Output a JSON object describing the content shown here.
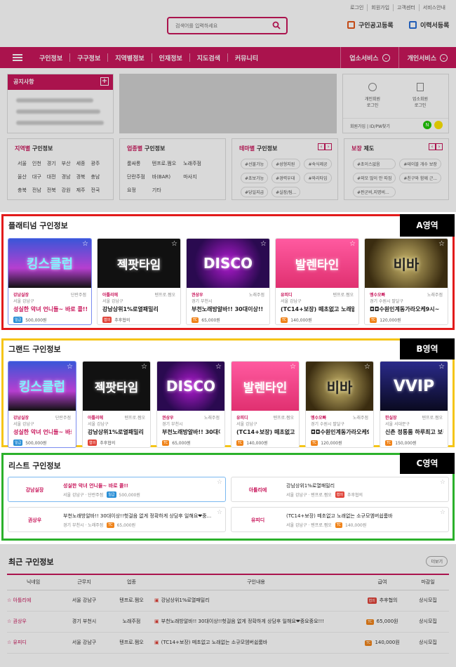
{
  "topnav": [
    "로그인",
    "회원가입",
    "고객센터",
    "서비스안내"
  ],
  "search": {
    "placeholder": "검색어를 입력하세요"
  },
  "links": {
    "job_post": "구인공고등록",
    "resume": "이력서등록"
  },
  "nav": {
    "items": [
      "구인정보",
      "구구정보",
      "지역별정보",
      "인재정보",
      "지도검색",
      "커뮤니티"
    ],
    "biz": "업소서비스",
    "personal": "개인서비스"
  },
  "notice": {
    "title": "공지사항"
  },
  "login": {
    "biz": "개인회원\n로그인",
    "biz2": "업소회원\n로그인",
    "links": "회원가입 | ID/PW찾기"
  },
  "region_box": {
    "title": "지역별",
    "suffix": " 구인정보",
    "items": [
      "서울",
      "인천",
      "경기",
      "부산",
      "세종",
      "광주",
      "울산",
      "대구",
      "대전",
      "경남",
      "경북",
      "충남",
      "충북",
      "전남",
      "전북",
      "강원",
      "제주",
      "전국"
    ]
  },
  "job_box": {
    "title": "업종별",
    "suffix": " 구인정보",
    "items": [
      "룸싸롱",
      "텐프로.쩜오",
      "노래주점",
      "단란주점",
      "바(BAR)",
      "마사지",
      "요정",
      "기타"
    ]
  },
  "theme_box": {
    "title": "테마별",
    "suffix": " 구인정보",
    "items": [
      "#선불가능",
      "#성형지원",
      "#숙식제공",
      "#초보가능",
      "#경력우대",
      "#와리타임",
      "#당일지급",
      "#실장/팀..."
    ]
  },
  "guar_box": {
    "title": "보장",
    "suffix": " 제도",
    "items": [
      "#초이스없음",
      "#테이블 개수 보장",
      "#외모 많이 안 따짐",
      "#친구와 함께 근...",
      "#판군비,지명비..."
    ]
  },
  "sections": {
    "platinum": {
      "title": "플래티넘 구인정보",
      "label": "A영역"
    },
    "grand": {
      "title": "그랜드 구인정보",
      "label": "B영역"
    },
    "list": {
      "title": "리스트 구인정보",
      "label": "C영역"
    }
  },
  "cards": [
    {
      "thumb": "킹스클럽",
      "name": "강남실장",
      "type": "단란주점",
      "loc": "서울 강남구",
      "title": "성실한 악녀 언니들~ 바로 콜!!",
      "pay_badge": "일급",
      "pay": "500,000원"
    },
    {
      "thumb": "젝팟타임",
      "name": "아틀리에",
      "type": "텐프로.쩜오",
      "loc": "서울 강남구",
      "title": "강남상위1%로열패밀리",
      "pay_badge": "협의",
      "pay": "추후협의"
    },
    {
      "thumb": "DISCO",
      "name": "권상우",
      "type": "노래주점",
      "loc": "경기 부천시",
      "title": "부천노래방알바!! 30대이상!!",
      "pay_badge": "TC",
      "pay": "65,000원"
    },
    {
      "thumb": "발렌타인",
      "name": "유피디",
      "type": "텐프로.쩜오",
      "loc": "서울 강남구",
      "title": "(TC14+보장) 떼초없고 노래없는",
      "pay_badge": "TC",
      "pay": "140,000원"
    },
    {
      "thumb": "비바",
      "name": "멩수오빠",
      "type": "노래주점",
      "loc": "경기 수원시 팔달구",
      "title": "◘◘수원인계동가라오케9시~",
      "pay_badge": "TC",
      "pay": "120,000원"
    },
    {
      "thumb": "VVIP",
      "name": "한실장",
      "type": "텐프로.쩜오",
      "loc": "서울 서대문구",
      "title": "신촌 정통룸 하루최고 보장",
      "pay_badge": "TC",
      "pay": "150,000원"
    }
  ],
  "list_rows": [
    {
      "name": "강남실장",
      "title": "성실한 악녀 언니들~ 바로 콜!!",
      "loc": "서울 강남구 · 단란주점",
      "badge": "일급",
      "pay": "500,000원"
    },
    {
      "name": "아틀리에",
      "title": "강남상위1%로열패밀리",
      "loc": "서울 강남구 · 텐프로.쩜오",
      "badge": "협의",
      "pay": "추후협의"
    },
    {
      "name": "권상우",
      "title": "부천노래방알바!! 30대이상!!헛걸음 없게 정확하게 상담후 일해요❤중...",
      "loc": "경기 부천시 · 노래주점",
      "badge": "TC",
      "pay": "65,000원"
    },
    {
      "name": "유피디",
      "title": "(TC14+보장) 떼초없고 노래없는 소규모엠버쉽룸바",
      "loc": "서울 강남구 · 텐프로.쩜오",
      "badge": "TC",
      "pay": "140,000원"
    }
  ],
  "recent": {
    "title": "최근 구인정보",
    "more": "더보기",
    "headers": [
      "닉네임",
      "근무지",
      "업종",
      "구인내용",
      "급여",
      "마감일"
    ],
    "rows": [
      {
        "name": "아틀리에",
        "loc": "서울 강남구",
        "type": "텐프로.쩜오",
        "content": "강남상위1%로열패밀리",
        "badge": "협의",
        "pay": "추후협의",
        "deadline": "상시모집"
      },
      {
        "name": "권상우",
        "loc": "경기 부천시",
        "type": "노래주점",
        "content": "부천노래방알바!! 30대이상!!헛걸음 없게 정확하게 상담후 일해요❤중요중요!!!",
        "badge": "TC",
        "pay": "65,000원",
        "deadline": "상시모집"
      },
      {
        "name": "유피디",
        "loc": "서울 강남구",
        "type": "텐프로.쩜오",
        "content": "(TC14+보장) 떼초없고 노래없는 소규모엠버쉽룸바",
        "badge": "TC",
        "pay": "140,000원",
        "deadline": "상시모집"
      }
    ]
  }
}
